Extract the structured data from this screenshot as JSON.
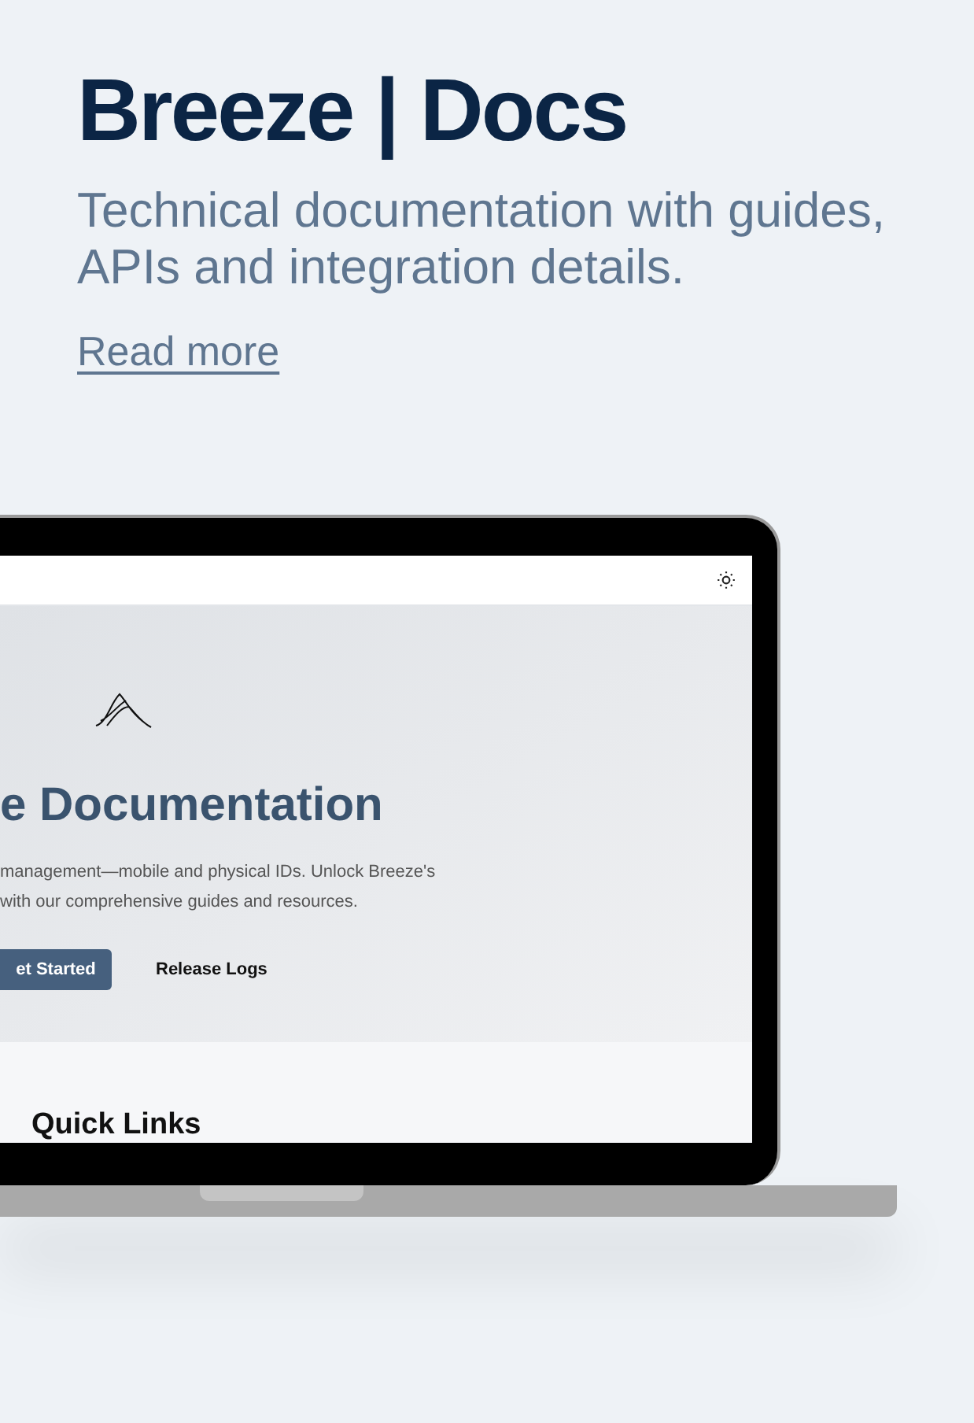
{
  "card": {
    "title": "Breeze | Docs",
    "subtitle": "Technical documentation with guides, APIs and integration details.",
    "link": "Read more"
  },
  "laptop_screen": {
    "heading": "e Documentation",
    "description_lines": [
      "management—mobile and physical IDs. Unlock Breeze's",
      "with our comprehensive guides and resources."
    ],
    "buttons": [
      {
        "label": "et Started",
        "kind": "primary"
      },
      {
        "label": "Release Logs",
        "kind": "plain"
      }
    ],
    "section_title": "Quick Links"
  }
}
